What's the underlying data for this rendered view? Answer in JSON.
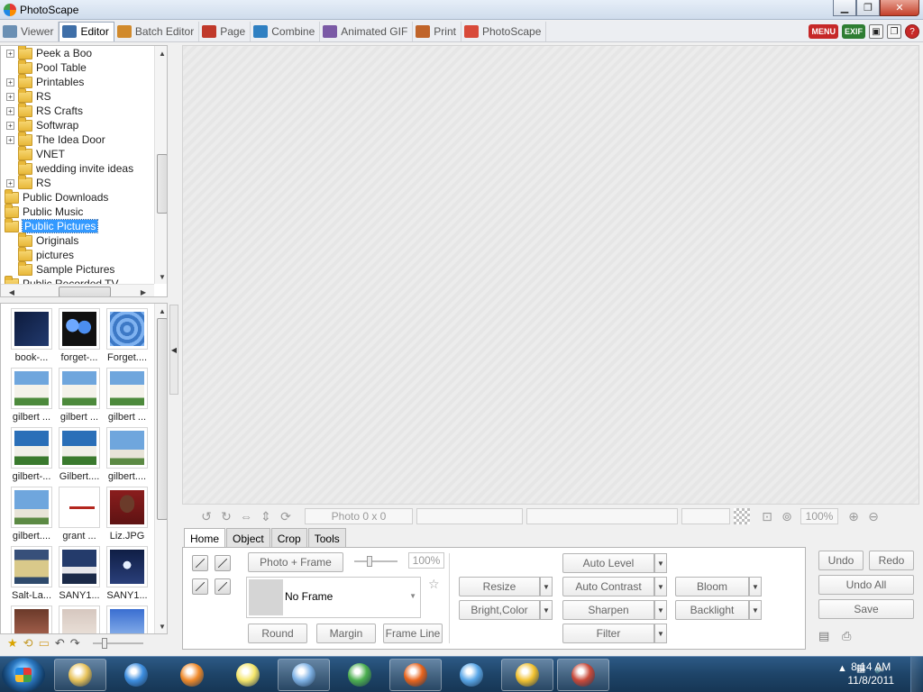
{
  "window": {
    "title": "PhotoScape"
  },
  "tabs": [
    {
      "label": "Viewer",
      "active": false,
      "icon": "viewer-icon",
      "color": "#6a8fb3"
    },
    {
      "label": "Editor",
      "active": true,
      "icon": "editor-icon",
      "color": "#3f6fa8"
    },
    {
      "label": "Batch Editor",
      "active": false,
      "icon": "batch-editor-icon",
      "color": "#d18a2c"
    },
    {
      "label": "Page",
      "active": false,
      "icon": "page-icon",
      "color": "#c0392b"
    },
    {
      "label": "Combine",
      "active": false,
      "icon": "combine-icon",
      "color": "#2f80c2"
    },
    {
      "label": "Animated GIF",
      "active": false,
      "icon": "gif-icon",
      "color": "#7b5aa6"
    },
    {
      "label": "Print",
      "active": false,
      "icon": "print-icon",
      "color": "#c0642a"
    },
    {
      "label": "PhotoScape",
      "active": false,
      "icon": "photoscape-icon",
      "color": "#d84a3a"
    }
  ],
  "toolbar_right": {
    "menu": "MENU",
    "exif": "EXIF"
  },
  "tree": {
    "items": [
      {
        "label": "Peek a Boo",
        "level": 1,
        "expander": "+"
      },
      {
        "label": "Pool Table",
        "level": 1,
        "expander": ""
      },
      {
        "label": "Printables",
        "level": 1,
        "expander": "+"
      },
      {
        "label": "RS",
        "level": 1,
        "expander": "+"
      },
      {
        "label": "RS Crafts",
        "level": 1,
        "expander": "+"
      },
      {
        "label": "Softwrap",
        "level": 1,
        "expander": "+"
      },
      {
        "label": "The Idea Door",
        "level": 1,
        "expander": "+"
      },
      {
        "label": "VNET",
        "level": 1,
        "expander": ""
      },
      {
        "label": "wedding invite ideas",
        "level": 1,
        "expander": ""
      },
      {
        "label": "RS",
        "level": 1,
        "expander": "+"
      },
      {
        "label": "Public Downloads",
        "level": 0,
        "expander": ""
      },
      {
        "label": "Public Music",
        "level": 0,
        "expander": ""
      },
      {
        "label": "Public Pictures",
        "level": 0,
        "expander": "",
        "selected": true
      },
      {
        "label": "Originals",
        "level": 1,
        "expander": ""
      },
      {
        "label": "pictures",
        "level": 1,
        "expander": ""
      },
      {
        "label": "Sample Pictures",
        "level": 1,
        "expander": ""
      },
      {
        "label": "Public Recorded TV",
        "level": 0,
        "expander": ""
      }
    ]
  },
  "thumbnails": [
    {
      "caption": "book-...",
      "style": "img-book"
    },
    {
      "caption": "forget-...",
      "style": "img-flower"
    },
    {
      "caption": "Forget....",
      "style": "img-forget"
    },
    {
      "caption": "gilbert ...",
      "style": "img-temple"
    },
    {
      "caption": "gilbert ...",
      "style": "img-temple"
    },
    {
      "caption": "gilbert ...",
      "style": "img-temple"
    },
    {
      "caption": "gilbert-...",
      "style": "img-temple2"
    },
    {
      "caption": "Gilbert....",
      "style": "img-temple2"
    },
    {
      "caption": "gilbert....",
      "style": "img-temple3"
    },
    {
      "caption": "gilbert....",
      "style": "img-temple3"
    },
    {
      "caption": "grant ...",
      "style": "img-grant"
    },
    {
      "caption": "Liz.JPG",
      "style": "img-liz"
    },
    {
      "caption": "Salt-La...",
      "style": "img-salt"
    },
    {
      "caption": "SANY1...",
      "style": "img-sany1"
    },
    {
      "caption": "SANY1...",
      "style": "img-sany2"
    },
    {
      "caption": "",
      "style": "img-row5a"
    },
    {
      "caption": "",
      "style": "img-row5b"
    },
    {
      "caption": "",
      "style": "img-row5c"
    }
  ],
  "status": {
    "photo_size": "Photo 0 x 0",
    "zoom": "100%"
  },
  "editor_tabs": [
    {
      "label": "Home",
      "active": true
    },
    {
      "label": "Object",
      "active": false
    },
    {
      "label": "Crop",
      "active": false
    },
    {
      "label": "Tools",
      "active": false
    }
  ],
  "home_panel": {
    "photo_frame": "Photo + Frame",
    "frame_percent": "100%",
    "frame_name": "No Frame",
    "round": "Round",
    "margin": "Margin",
    "frame_line": "Frame Line",
    "resize": "Resize",
    "bright_color": "Bright,Color",
    "auto_level": "Auto Level",
    "auto_contrast": "Auto Contrast",
    "sharpen": "Sharpen",
    "filter": "Filter",
    "bloom": "Bloom",
    "backlight": "Backlight"
  },
  "actions": {
    "undo": "Undo",
    "redo": "Redo",
    "undo_all": "Undo All",
    "save": "Save"
  },
  "taskbar": {
    "time": "8:14 AM",
    "date": "11/8/2011",
    "apps": [
      {
        "name": "explorer",
        "color": "#e8c35a",
        "open": true
      },
      {
        "name": "internet-explorer",
        "color": "#3d8ee0",
        "open": false
      },
      {
        "name": "media-player",
        "color": "#f08a2a",
        "open": false
      },
      {
        "name": "sticky-notes",
        "color": "#f5e66a",
        "open": false
      },
      {
        "name": "control-panel",
        "color": "#7fb2e5",
        "open": true
      },
      {
        "name": "chrome",
        "color": "#4caf50",
        "open": false
      },
      {
        "name": "firefox",
        "color": "#e8641d",
        "open": true
      },
      {
        "name": "safari",
        "color": "#5aa7e8",
        "open": false
      },
      {
        "name": "favorites-app",
        "color": "#f2c230",
        "open": true
      },
      {
        "name": "photoscape",
        "color": "#c94a3a",
        "open": true
      }
    ]
  }
}
